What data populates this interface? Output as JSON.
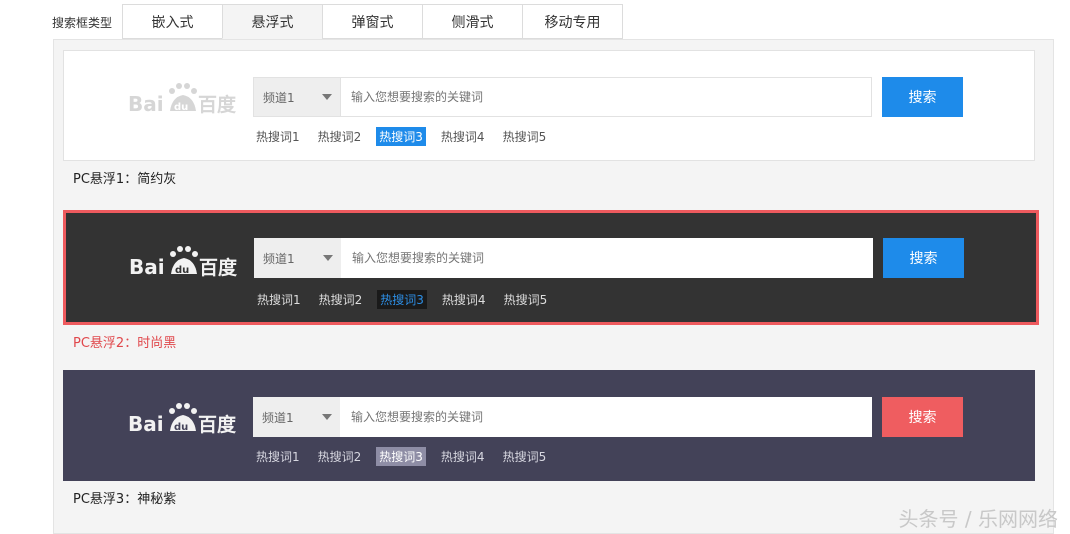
{
  "type_label": "搜索框类型",
  "tabs": [
    "嵌入式",
    "悬浮式",
    "弹窗式",
    "侧滑式",
    "移动专用"
  ],
  "active_tab": "悬浮式",
  "logo": {
    "text": "Baidu百度"
  },
  "cards": [
    {
      "channel": "频道1",
      "placeholder": "输入您想要搜索的关键词",
      "button": "搜索",
      "hot": [
        "热搜词1",
        "热搜词2",
        "热搜词3",
        "热搜词4",
        "热搜词5"
      ],
      "selected_hot": "热搜词3",
      "caption": "PC悬浮1：简约灰"
    },
    {
      "channel": "频道1",
      "placeholder": "输入您想要搜索的关键词",
      "button": "搜索",
      "hot": [
        "热搜词1",
        "热搜词2",
        "热搜词3",
        "热搜词4",
        "热搜词5"
      ],
      "selected_hot": "热搜词3",
      "caption": "PC悬浮2：时尚黑"
    },
    {
      "channel": "频道1",
      "placeholder": "输入您想要搜索的关键词",
      "button": "搜索",
      "hot": [
        "热搜词1",
        "热搜词2",
        "热搜词3",
        "热搜词4",
        "热搜词5"
      ],
      "selected_hot": "热搜词3",
      "caption": "PC悬浮3：神秘紫"
    }
  ],
  "colors": {
    "blue_button": "#1e8bea",
    "red_button": "#ef5d60",
    "black_bg": "#333333",
    "purple_bg": "#434258",
    "highlight_border": "#ee5a5e"
  },
  "watermark": "头条号 / 乐网网络"
}
